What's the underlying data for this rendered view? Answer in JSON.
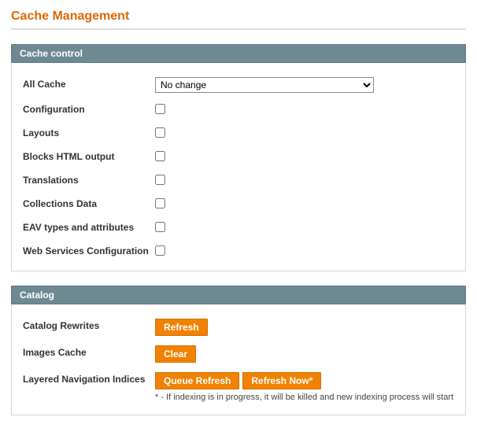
{
  "page": {
    "title": "Cache Management"
  },
  "cacheControl": {
    "header": "Cache control",
    "allCache": {
      "label": "All Cache",
      "selected": "No change"
    },
    "items": [
      {
        "label": "Configuration"
      },
      {
        "label": "Layouts"
      },
      {
        "label": "Blocks HTML output"
      },
      {
        "label": "Translations"
      },
      {
        "label": "Collections Data"
      },
      {
        "label": "EAV types and attributes"
      },
      {
        "label": "Web Services Configuration"
      }
    ]
  },
  "catalog": {
    "header": "Catalog",
    "rewrites": {
      "label": "Catalog Rewrites",
      "refresh": "Refresh"
    },
    "imagesCache": {
      "label": "Images Cache",
      "clear": "Clear"
    },
    "layeredNav": {
      "label": "Layered Navigation Indices",
      "queue": "Queue Refresh",
      "now": "Refresh Now*",
      "note": "* - If indexing is in progress, it will be killed and new indexing process will start"
    }
  }
}
